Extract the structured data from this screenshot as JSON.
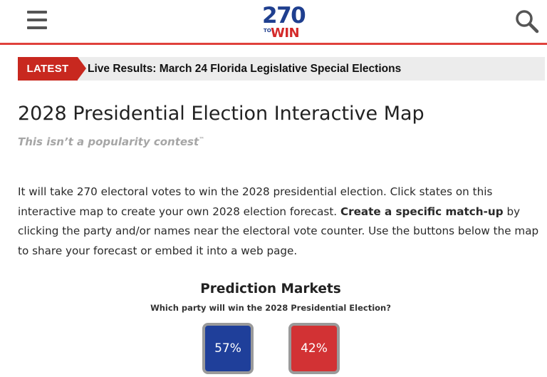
{
  "header": {
    "logo": {
      "number": "270",
      "to": "TO",
      "win": "WIN"
    },
    "menu_icon": "hamburger-menu-icon",
    "search_icon": "search-icon",
    "accent_color": "#e0413c"
  },
  "ticker": {
    "badge": "LATEST",
    "headline": "Live Results: March 24 Florida Legislative Special Elections",
    "badge_color": "#c8281f"
  },
  "page": {
    "title": "2028 Presidential Election Interactive Map",
    "tagline": "This isn’t a popularity contest",
    "tagline_mark": "™"
  },
  "intro": {
    "part1": "It will take 270 electoral votes to win the 2028 presidential election. Click states on this interactive map to create your own 2028 election forecast. ",
    "bold": "Create a specific match-up",
    "part2": " by clicking the party and/or names near the electoral vote counter. Use the buttons below the map to share your forecast or embed it into a web page."
  },
  "prediction_markets": {
    "title": "Prediction Markets",
    "question": "Which party will win the 2028 Presidential Election?",
    "options": [
      {
        "label": "57%",
        "value": 57,
        "color": "#1f3f9a"
      },
      {
        "label": "42%",
        "value": 42,
        "color": "#d23234"
      }
    ]
  }
}
